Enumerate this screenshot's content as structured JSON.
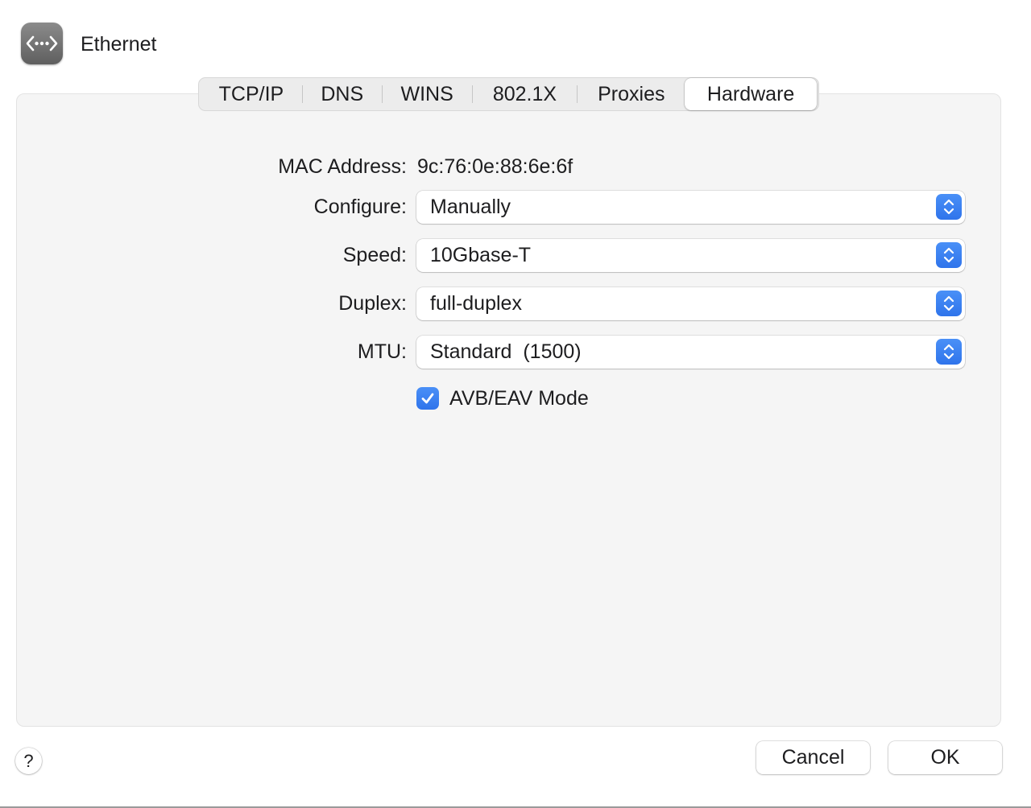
{
  "header": {
    "title": "Ethernet",
    "icon": "ethernet-icon"
  },
  "tabs": [
    {
      "label": "TCP/IP",
      "selected": false
    },
    {
      "label": "DNS",
      "selected": false
    },
    {
      "label": "WINS",
      "selected": false
    },
    {
      "label": "802.1X",
      "selected": false
    },
    {
      "label": "Proxies",
      "selected": false
    },
    {
      "label": "Hardware",
      "selected": true
    }
  ],
  "form": {
    "mac_label": "MAC Address:",
    "mac_value": "9c:76:0e:88:6e:6f",
    "configure_label": "Configure:",
    "configure_value": "Manually",
    "speed_label": "Speed:",
    "speed_value": "10Gbase-T",
    "duplex_label": "Duplex:",
    "duplex_value": "full-duplex",
    "mtu_label": "MTU:",
    "mtu_value": "Standard  (1500)",
    "avb_label": "AVB/EAV Mode",
    "avb_checked": true
  },
  "footer": {
    "help_label": "?",
    "cancel_label": "Cancel",
    "ok_label": "OK"
  },
  "colors": {
    "accent": "#3b82f6",
    "panel_bg": "#f5f5f5",
    "text": "#1d1d1f"
  }
}
